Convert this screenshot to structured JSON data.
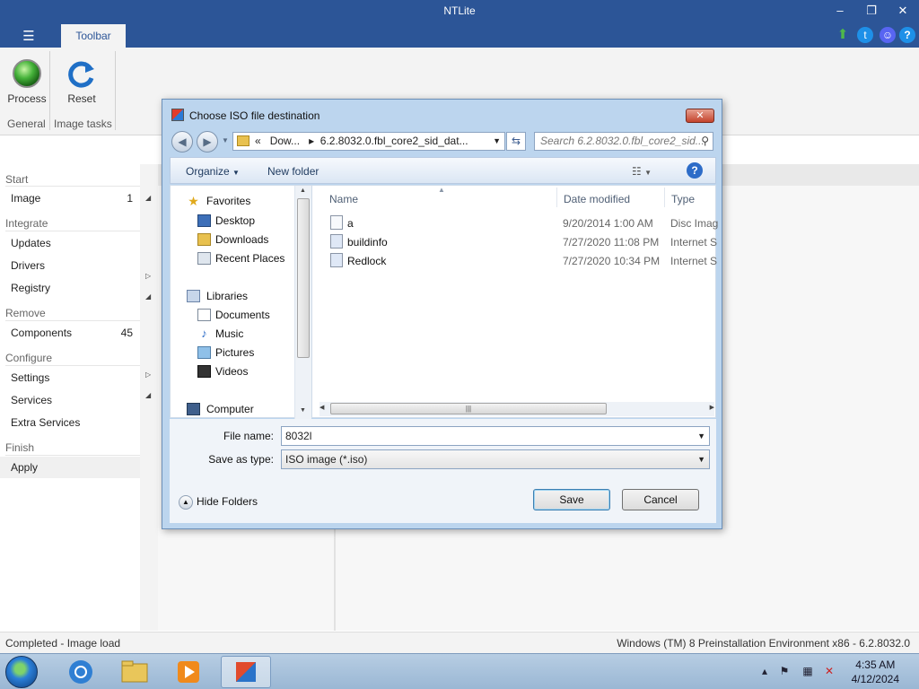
{
  "window": {
    "title": "NTLite",
    "controls": {
      "minimize": "–",
      "restore": "❐",
      "close": "✕"
    }
  },
  "ribbon": {
    "menu_icon": "☰",
    "tab": "Toolbar",
    "buttons": [
      {
        "label": "Process",
        "icon": "green-orb-icon"
      },
      {
        "label": "Reset",
        "icon": "refresh-icon"
      }
    ],
    "groups": [
      "General",
      "Image tasks"
    ],
    "top_icons": [
      "up-arrow-icon",
      "twitter-icon",
      "discord-icon",
      "help-icon"
    ]
  },
  "sidebar": {
    "sections": [
      {
        "title": "Start",
        "items": [
          {
            "label": "Image",
            "count": "1"
          }
        ]
      },
      {
        "title": "Integrate",
        "items": [
          {
            "label": "Updates"
          },
          {
            "label": "Drivers"
          },
          {
            "label": "Registry"
          }
        ]
      },
      {
        "title": "Remove",
        "items": [
          {
            "label": "Components",
            "count": "45"
          }
        ]
      },
      {
        "title": "Configure",
        "items": [
          {
            "label": "Settings"
          },
          {
            "label": "Services"
          },
          {
            "label": "Extra Services"
          }
        ]
      },
      {
        "title": "Finish",
        "items": [
          {
            "label": "Apply"
          }
        ]
      }
    ]
  },
  "status": {
    "left": "Completed - Image load",
    "right": "Windows (TM) 8 Preinstallation Environment x86 - 6.2.8032.0"
  },
  "dialog": {
    "title": "Choose ISO file destination",
    "breadcrumb": {
      "prefix": "«",
      "part1": "Dow...",
      "sep": "▸",
      "part2": "6.2.8032.0.fbl_core2_sid_dat..."
    },
    "search_placeholder": "Search 6.2.8032.0.fbl_core2_sid...",
    "commands": {
      "organize": "Organize",
      "new_folder": "New folder"
    },
    "nav": {
      "favorites": "Favorites",
      "favorite_items": [
        "Desktop",
        "Downloads",
        "Recent Places"
      ],
      "libraries": "Libraries",
      "library_items": [
        "Documents",
        "Music",
        "Pictures",
        "Videos"
      ],
      "computer": "Computer"
    },
    "columns": {
      "name": "Name",
      "date": "Date modified",
      "type": "Type"
    },
    "files": [
      {
        "name": "a",
        "date": "9/20/2014 1:00 AM",
        "type": "Disc Imag"
      },
      {
        "name": "buildinfo",
        "date": "7/27/2020 11:08 PM",
        "type": "Internet S"
      },
      {
        "name": "Redlock",
        "date": "7/27/2020 10:34 PM",
        "type": "Internet S"
      }
    ],
    "file_name_label": "File name:",
    "file_name_value": "8032l",
    "save_type_label": "Save as type:",
    "save_type_value": "ISO image (*.iso)",
    "hide_folders": "Hide Folders",
    "save": "Save",
    "cancel": "Cancel"
  },
  "taskbar": {
    "time": "4:35 AM",
    "date": "4/12/2024"
  }
}
